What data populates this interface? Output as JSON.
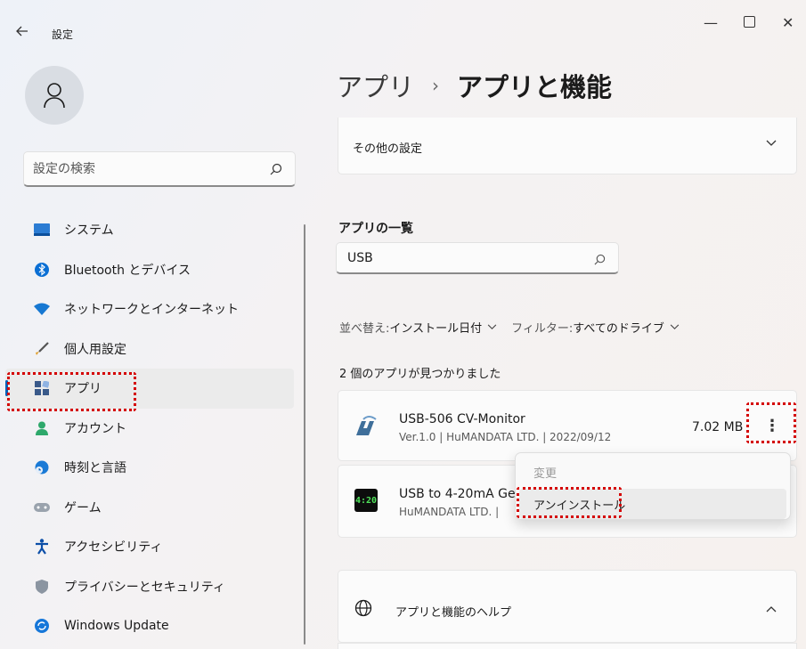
{
  "window": {
    "title": "設定",
    "back_icon": "arrow-left-icon",
    "minimize_glyph": "—",
    "close_glyph": "✕"
  },
  "sidebar": {
    "search_placeholder": "設定の検索",
    "items": [
      {
        "label": "システム",
        "icon": "system-icon"
      },
      {
        "label": "Bluetooth とデバイス",
        "icon": "bluetooth-icon"
      },
      {
        "label": "ネットワークとインターネット",
        "icon": "wifi-icon"
      },
      {
        "label": "個人用設定",
        "icon": "brush-icon"
      },
      {
        "label": "アプリ",
        "icon": "apps-icon",
        "active": true
      },
      {
        "label": "アカウント",
        "icon": "account-icon"
      },
      {
        "label": "時刻と言語",
        "icon": "globe-clock-icon"
      },
      {
        "label": "ゲーム",
        "icon": "gamepad-icon"
      },
      {
        "label": "アクセシビリティ",
        "icon": "accessibility-icon"
      },
      {
        "label": "プライバシーとセキュリティ",
        "icon": "shield-icon"
      },
      {
        "label": "Windows Update",
        "icon": "update-icon"
      }
    ]
  },
  "main": {
    "breadcrumb": {
      "parent": "アプリ",
      "separator": "›",
      "current": "アプリと機能"
    },
    "other_settings": {
      "label": "その他の設定",
      "chevron": "⌵"
    },
    "app_list": {
      "title": "アプリの一覧",
      "search_value": "USB",
      "sort_label": "並べ替え:",
      "sort_value": "インストール日付",
      "filter_label": "フィルター:",
      "filter_value": "すべてのドライブ",
      "dropdown_glyph": "⌵",
      "result_count": "2 個のアプリが見つかりました"
    },
    "apps": [
      {
        "name": "USB-506 CV-Monitor",
        "meta": "Ver.1.0  |  HuMANDATA LTD.  |  2022/09/12",
        "size": "7.02 MB",
        "more": "⋮"
      },
      {
        "name": "USB to 4-20mA Ge",
        "meta": "HuMANDATA LTD.  |",
        "logo_text": "4:20"
      }
    ],
    "context_menu": {
      "change": "変更",
      "uninstall": "アンインストール"
    },
    "help": {
      "label": "アプリと機能のヘルプ",
      "chevron": "⌃"
    }
  },
  "colors": {
    "accent": "#005fb8",
    "highlight": "#d40000"
  }
}
